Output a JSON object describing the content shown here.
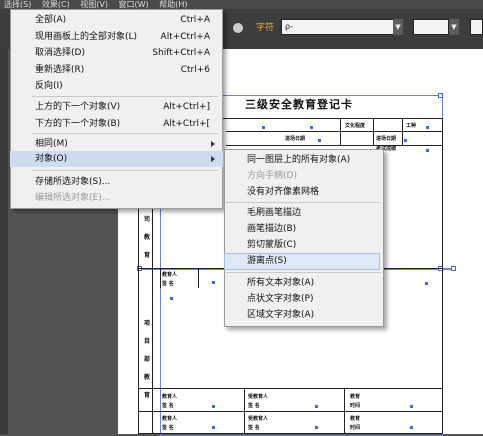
{
  "menubar": {
    "items": [
      "选择(S)",
      "效果(C)",
      "视图(V)",
      "窗口(W)",
      "帮助(H)"
    ]
  },
  "controlbar": {
    "char_label": "字符",
    "font_search_value": "ρ-"
  },
  "document": {
    "title": "三级安全教育登记卡",
    "row1": [
      "文化程度",
      "工种"
    ],
    "row2": [
      "进场日期",
      "进场日期",
      "考试成绩"
    ],
    "side_block_1": [
      "司",
      "教",
      "育"
    ],
    "side_block_2": [
      "项",
      "目",
      "部",
      "教",
      "育"
    ],
    "sig_rows": [
      {
        "c1": "教育人",
        "c2": "签  名",
        "c3": "受教育人",
        "c4": "签  名",
        "c5": "教育",
        "c6": "时间"
      },
      {
        "c1": "教育人",
        "c2": "签  名",
        "c3": "受教育人",
        "c4": "签  名",
        "c5": "教育",
        "c6": "时间"
      }
    ],
    "mid_row": {
      "c1": "教育人",
      "c2": "签  名"
    }
  },
  "select_menu": {
    "items": [
      {
        "label": "全部(A)",
        "shortcut": "Ctrl+A"
      },
      {
        "label": "现用画板上的全部对象(L)",
        "shortcut": "Alt+Ctrl+A"
      },
      {
        "label": "取消选择(D)",
        "shortcut": "Shift+Ctrl+A"
      },
      {
        "label": "重新选择(R)",
        "shortcut": "Ctrl+6"
      },
      {
        "label": "反向(I)",
        "shortcut": ""
      },
      {
        "label": "上方的下一个对象(V)",
        "shortcut": "Alt+Ctrl+]"
      },
      {
        "label": "下方的下一个对象(B)",
        "shortcut": "Alt+Ctrl+["
      },
      {
        "label": "相同(M)",
        "shortcut": ""
      },
      {
        "label": "对象(O)",
        "shortcut": ""
      },
      {
        "label": "存储所选对象(S)...",
        "shortcut": ""
      },
      {
        "label": "编辑所选对象(E)...",
        "shortcut": ""
      }
    ]
  },
  "object_submenu": {
    "items": [
      "同一图层上的所有对象(A)",
      "方向手柄(D)",
      "没有对齐像素网格",
      "毛刷画笔描边",
      "画笔描边(B)",
      "剪切蒙版(C)",
      "游离点(S)",
      "所有文本对象(A)",
      "点状文字对象(P)",
      "区域文字对象(A)"
    ]
  }
}
